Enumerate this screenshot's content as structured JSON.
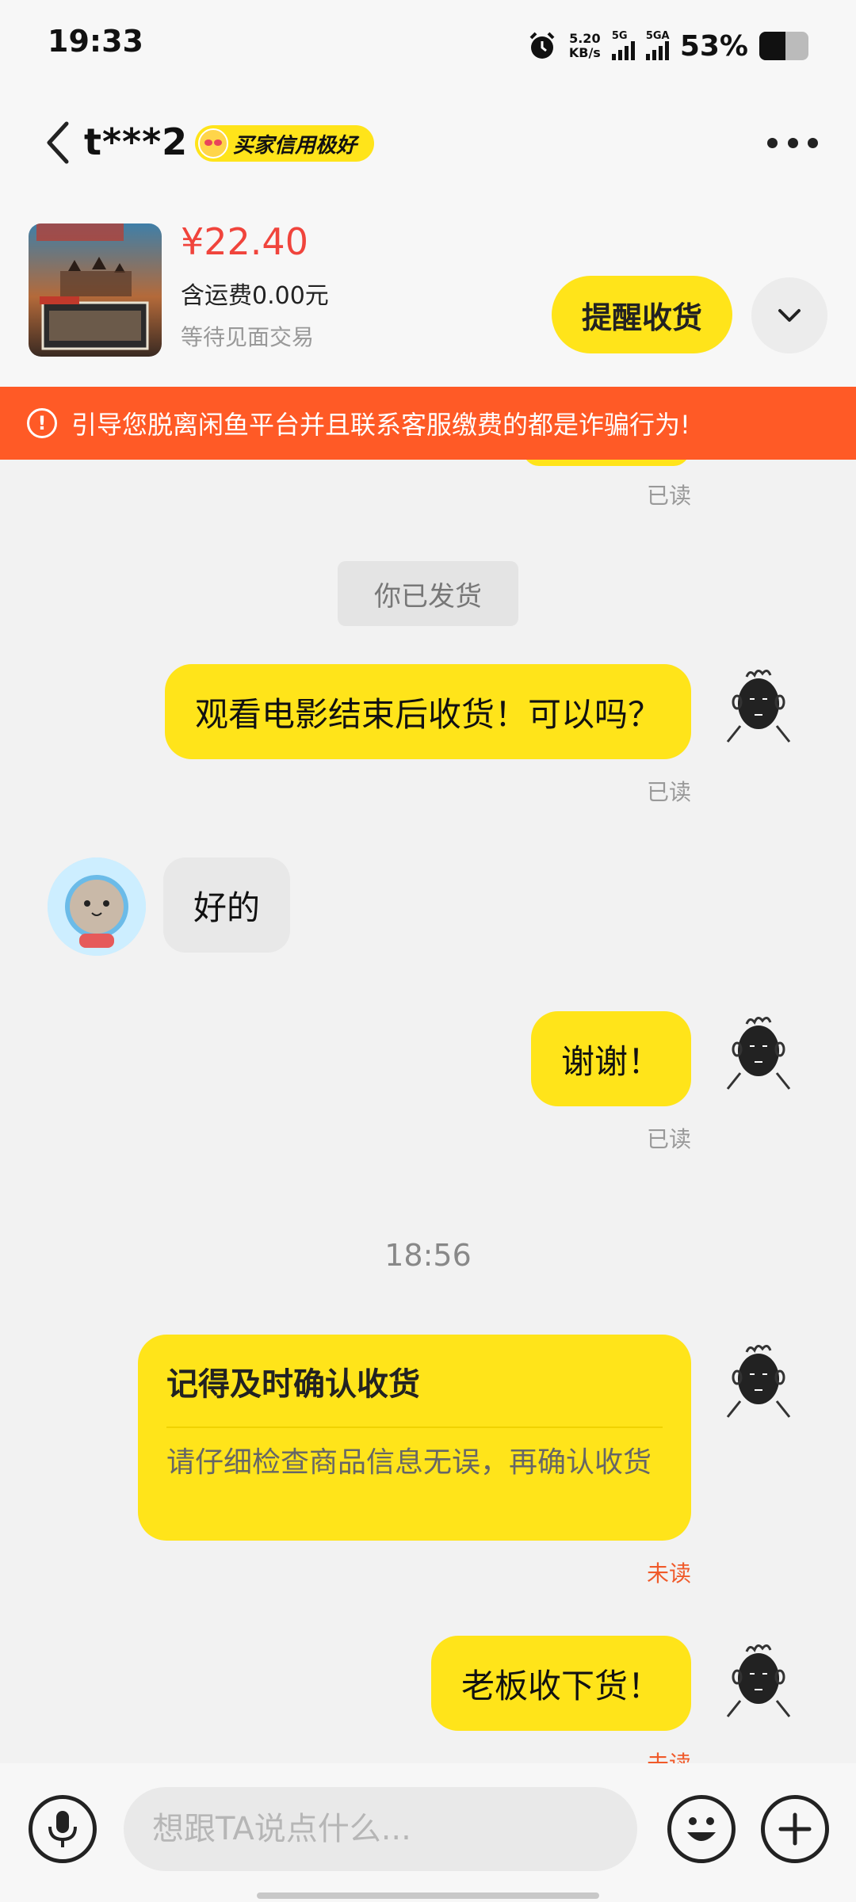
{
  "status_bar": {
    "time": "19:33",
    "net_speed_value": "5.20",
    "net_speed_unit": "KB/s",
    "sim1_label": "5G",
    "sim2_label": "5GA",
    "battery_text": "53%",
    "battery_level": 0.53
  },
  "header": {
    "name": "t***2",
    "credit_badge": "买家信用极好"
  },
  "product": {
    "price": "¥22.40",
    "shipping": "含运费0.00元",
    "status": "等待见面交易",
    "remind_button": "提醒收货"
  },
  "warning": {
    "text": "引导您脱离闲鱼平台并且联系客服缴费的都是诈骗行为!"
  },
  "chat": {
    "read_label": "已读",
    "unread_label": "未读",
    "system_message": "你已发货",
    "messages": [
      {
        "from": "me",
        "text": "观看电影结束后收货！可以吗？",
        "status": "已读"
      },
      {
        "from": "them",
        "text": "好的"
      },
      {
        "from": "me",
        "text": "谢谢！",
        "status": "已读"
      },
      {
        "from": "me",
        "text": "老板收下货！",
        "status": "未读"
      }
    ],
    "time_label": "18:56",
    "card": {
      "title": "记得及时确认收货",
      "body": "请仔细检查商品信息无误，再确认收货",
      "status": "未读"
    }
  },
  "input": {
    "placeholder": "想跟TA说点什么..."
  },
  "colors": {
    "accent_yellow": "#ffe41a",
    "warning_orange": "#ff5a26",
    "price_red": "#f0443c",
    "unread_red": "#f05a2a"
  },
  "icons": [
    "back-arrow-icon",
    "more-dots-icon",
    "chevron-down-icon",
    "warning-icon",
    "microphone-icon",
    "emoji-icon",
    "plus-icon",
    "alarm-icon",
    "signal-icon",
    "battery-icon"
  ]
}
